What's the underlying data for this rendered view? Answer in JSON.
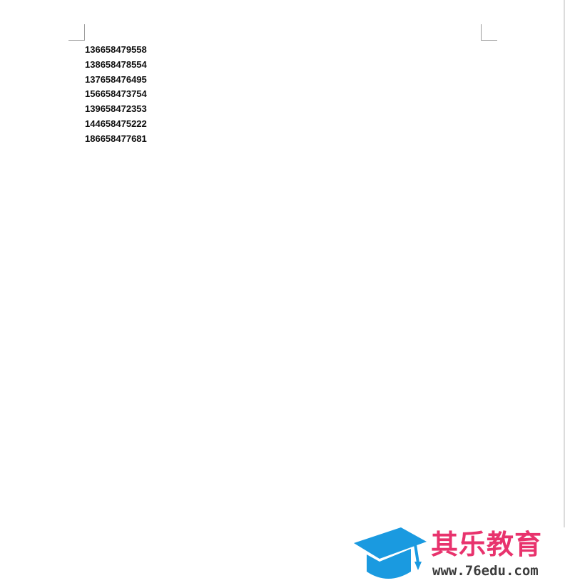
{
  "document": {
    "phone_numbers": [
      "136658479558",
      "138658478554",
      "137658476495",
      "156658473754",
      "139658472353",
      "144658475222",
      "186658477681"
    ]
  },
  "watermark": {
    "brand_name": "其乐教育",
    "url": "www.76edu.com",
    "icon": "graduation-cap-icon",
    "colors": {
      "cap": "#1a9ae0",
      "brand_text": "#e8336d",
      "url_text": "#3c3c3c"
    }
  }
}
